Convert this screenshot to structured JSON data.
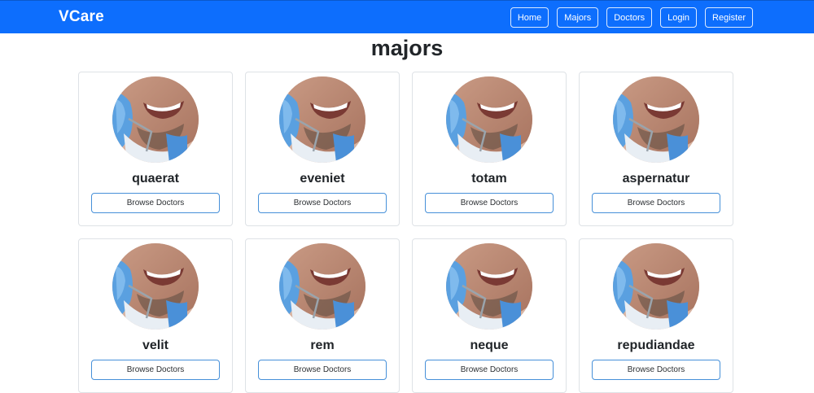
{
  "navbar": {
    "brand": "VCare",
    "links": [
      "Home",
      "Majors",
      "Doctors",
      "Login",
      "Register"
    ]
  },
  "page": {
    "title": "majors"
  },
  "majors": [
    {
      "name": "quaerat",
      "button_label": "Browse Doctors"
    },
    {
      "name": "eveniet",
      "button_label": "Browse Doctors"
    },
    {
      "name": "totam",
      "button_label": "Browse Doctors"
    },
    {
      "name": "aspernatur",
      "button_label": "Browse Doctors"
    },
    {
      "name": "velit",
      "button_label": "Browse Doctors"
    },
    {
      "name": "rem",
      "button_label": "Browse Doctors"
    },
    {
      "name": "neque",
      "button_label": "Browse Doctors"
    },
    {
      "name": "repudiandae",
      "button_label": "Browse Doctors"
    }
  ],
  "colors": {
    "navbar": "#0d6efd",
    "button_border": "#0d6efd",
    "text": "#212529"
  }
}
